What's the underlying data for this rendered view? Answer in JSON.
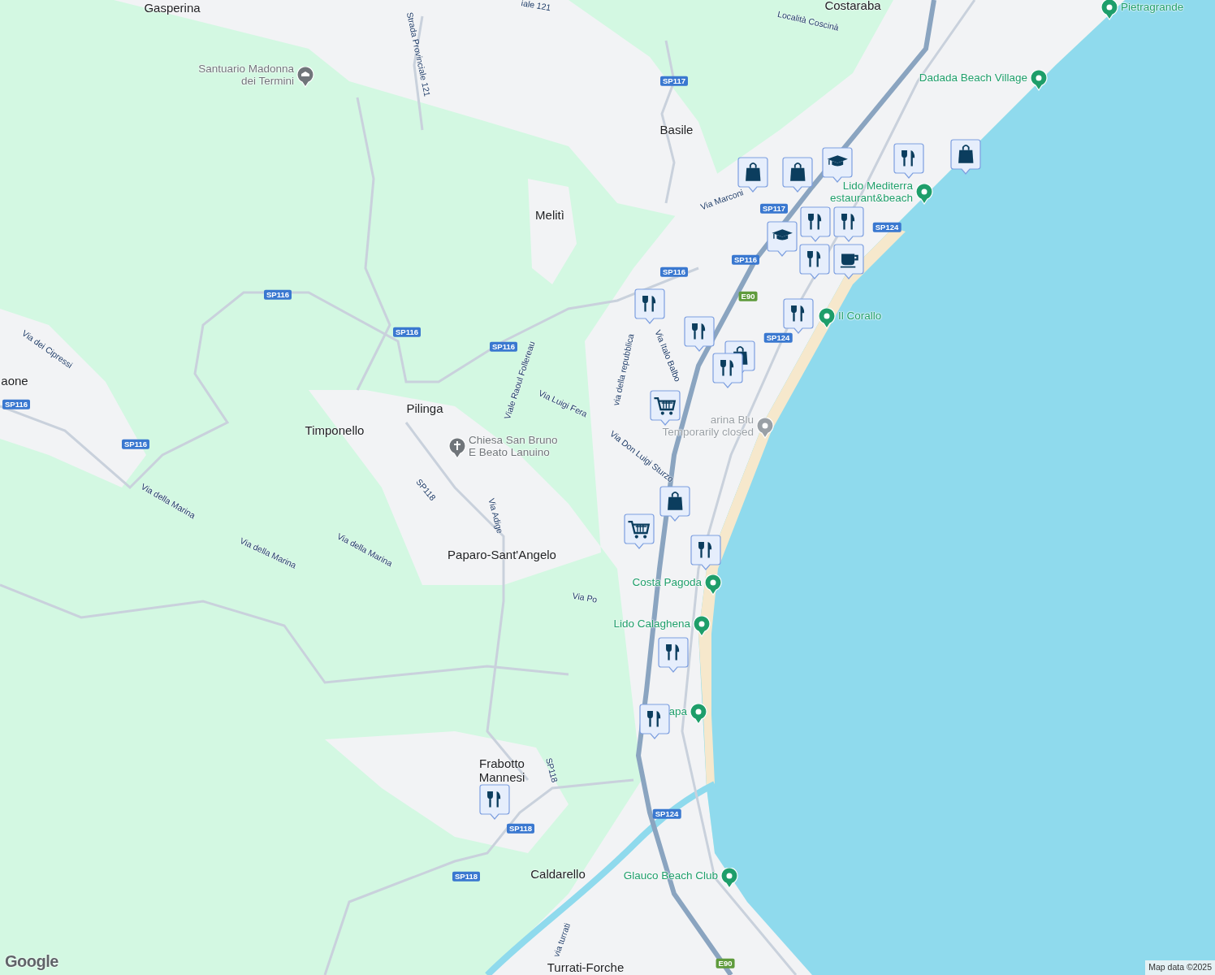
{
  "places": [
    {
      "name": "Gasperina"
    },
    {
      "name": "Costaraba"
    },
    {
      "name": "Basile"
    },
    {
      "name": "Melitì"
    },
    {
      "name": "Pilinga"
    },
    {
      "name": "Timponello"
    },
    {
      "name": "aone"
    },
    {
      "name": "Paparo-Sant'Angelo"
    },
    {
      "name": "Frabotto Mannesi"
    },
    {
      "name": "Caldarello"
    },
    {
      "name": "Turrati-Forche"
    }
  ],
  "streets": [
    {
      "name": "Località Coscinà"
    },
    {
      "name": "iale 121"
    },
    {
      "name": "Strada Provinciale 121"
    },
    {
      "name": "Via Marconi"
    },
    {
      "name": "via della repubblica"
    },
    {
      "name": "Via Italo Balbo"
    },
    {
      "name": "Viale Raoul Follereau"
    },
    {
      "name": "Via Luigi Fera"
    },
    {
      "name": "Via Don Luigi Sturzo"
    },
    {
      "name": "Via dei Cipressi"
    },
    {
      "name": "Via della Marina"
    },
    {
      "name": "Via della Marina"
    },
    {
      "name": "Via della Marina"
    },
    {
      "name": "SP118"
    },
    {
      "name": "Via Adige"
    },
    {
      "name": "Via Po"
    },
    {
      "name": "SP118"
    },
    {
      "name": "via turrati"
    }
  ],
  "shields": [
    {
      "text": "SP117",
      "kind": "provincial"
    },
    {
      "text": "SP117",
      "kind": "provincial"
    },
    {
      "text": "SP124",
      "kind": "provincial"
    },
    {
      "text": "SP116",
      "kind": "provincial"
    },
    {
      "text": "SP116",
      "kind": "provincial"
    },
    {
      "text": "SP116",
      "kind": "provincial"
    },
    {
      "text": "SP116",
      "kind": "provincial"
    },
    {
      "text": "SP116",
      "kind": "provincial"
    },
    {
      "text": "SP116",
      "kind": "provincial"
    },
    {
      "text": "SP116",
      "kind": "provincial"
    },
    {
      "text": "E90",
      "kind": "european"
    },
    {
      "text": "SP124",
      "kind": "provincial"
    },
    {
      "text": "SP124",
      "kind": "provincial"
    },
    {
      "text": "SP118",
      "kind": "provincial"
    },
    {
      "text": "SP118",
      "kind": "provincial"
    },
    {
      "text": "E90",
      "kind": "european"
    }
  ],
  "pois": [
    {
      "lines": [
        "Santuario Madonna",
        "dei Termini"
      ],
      "kind": "temple",
      "color": "#70757a"
    },
    {
      "lines": [
        "Pietragrande"
      ],
      "kind": "place",
      "color": "#1e9e6a"
    },
    {
      "lines": [
        "Dadada Beach Village"
      ],
      "kind": "place",
      "color": "#1e9e6a"
    },
    {
      "lines": [
        "Lido Mediterra",
        "estaurant&beach"
      ],
      "kind": "place",
      "color": "#1e9e6a"
    },
    {
      "lines": [
        "Il Corallo"
      ],
      "kind": "place",
      "color": "#1e9e6a"
    },
    {
      "lines": [
        "arina Blu",
        "Temporarily closed"
      ],
      "kind": "place",
      "color": "#9aa0a6"
    },
    {
      "lines": [
        "Costa Pagoda"
      ],
      "kind": "place",
      "color": "#1e9e6a"
    },
    {
      "lines": [
        "Lido Calaghena"
      ],
      "kind": "place",
      "color": "#1e9e6a"
    },
    {
      "lines": [
        "apa"
      ],
      "kind": "place",
      "color": "#1e9e6a"
    },
    {
      "lines": [
        "Glauco Beach Club"
      ],
      "kind": "place",
      "color": "#1e9e6a"
    },
    {
      "lines": [
        "Chiesa San Bruno",
        "E Beato Lanuino"
      ],
      "kind": "church",
      "color": "#70757a"
    }
  ],
  "markers": [
    {
      "kind": "shopping"
    },
    {
      "kind": "shopping"
    },
    {
      "kind": "school"
    },
    {
      "kind": "restaurant"
    },
    {
      "kind": "shopping"
    },
    {
      "kind": "restaurant"
    },
    {
      "kind": "school"
    },
    {
      "kind": "restaurant"
    },
    {
      "kind": "cafe"
    },
    {
      "kind": "restaurant"
    },
    {
      "kind": "restaurant"
    },
    {
      "kind": "restaurant"
    },
    {
      "kind": "restaurant"
    },
    {
      "kind": "shopping"
    },
    {
      "kind": "restaurant"
    },
    {
      "kind": "grocery"
    },
    {
      "kind": "shopping"
    },
    {
      "kind": "grocery"
    },
    {
      "kind": "restaurant"
    },
    {
      "kind": "restaurant"
    },
    {
      "kind": "restaurant"
    },
    {
      "kind": "restaurant"
    }
  ],
  "attribution": {
    "logo": "Google",
    "text": "Map data ©2025"
  }
}
